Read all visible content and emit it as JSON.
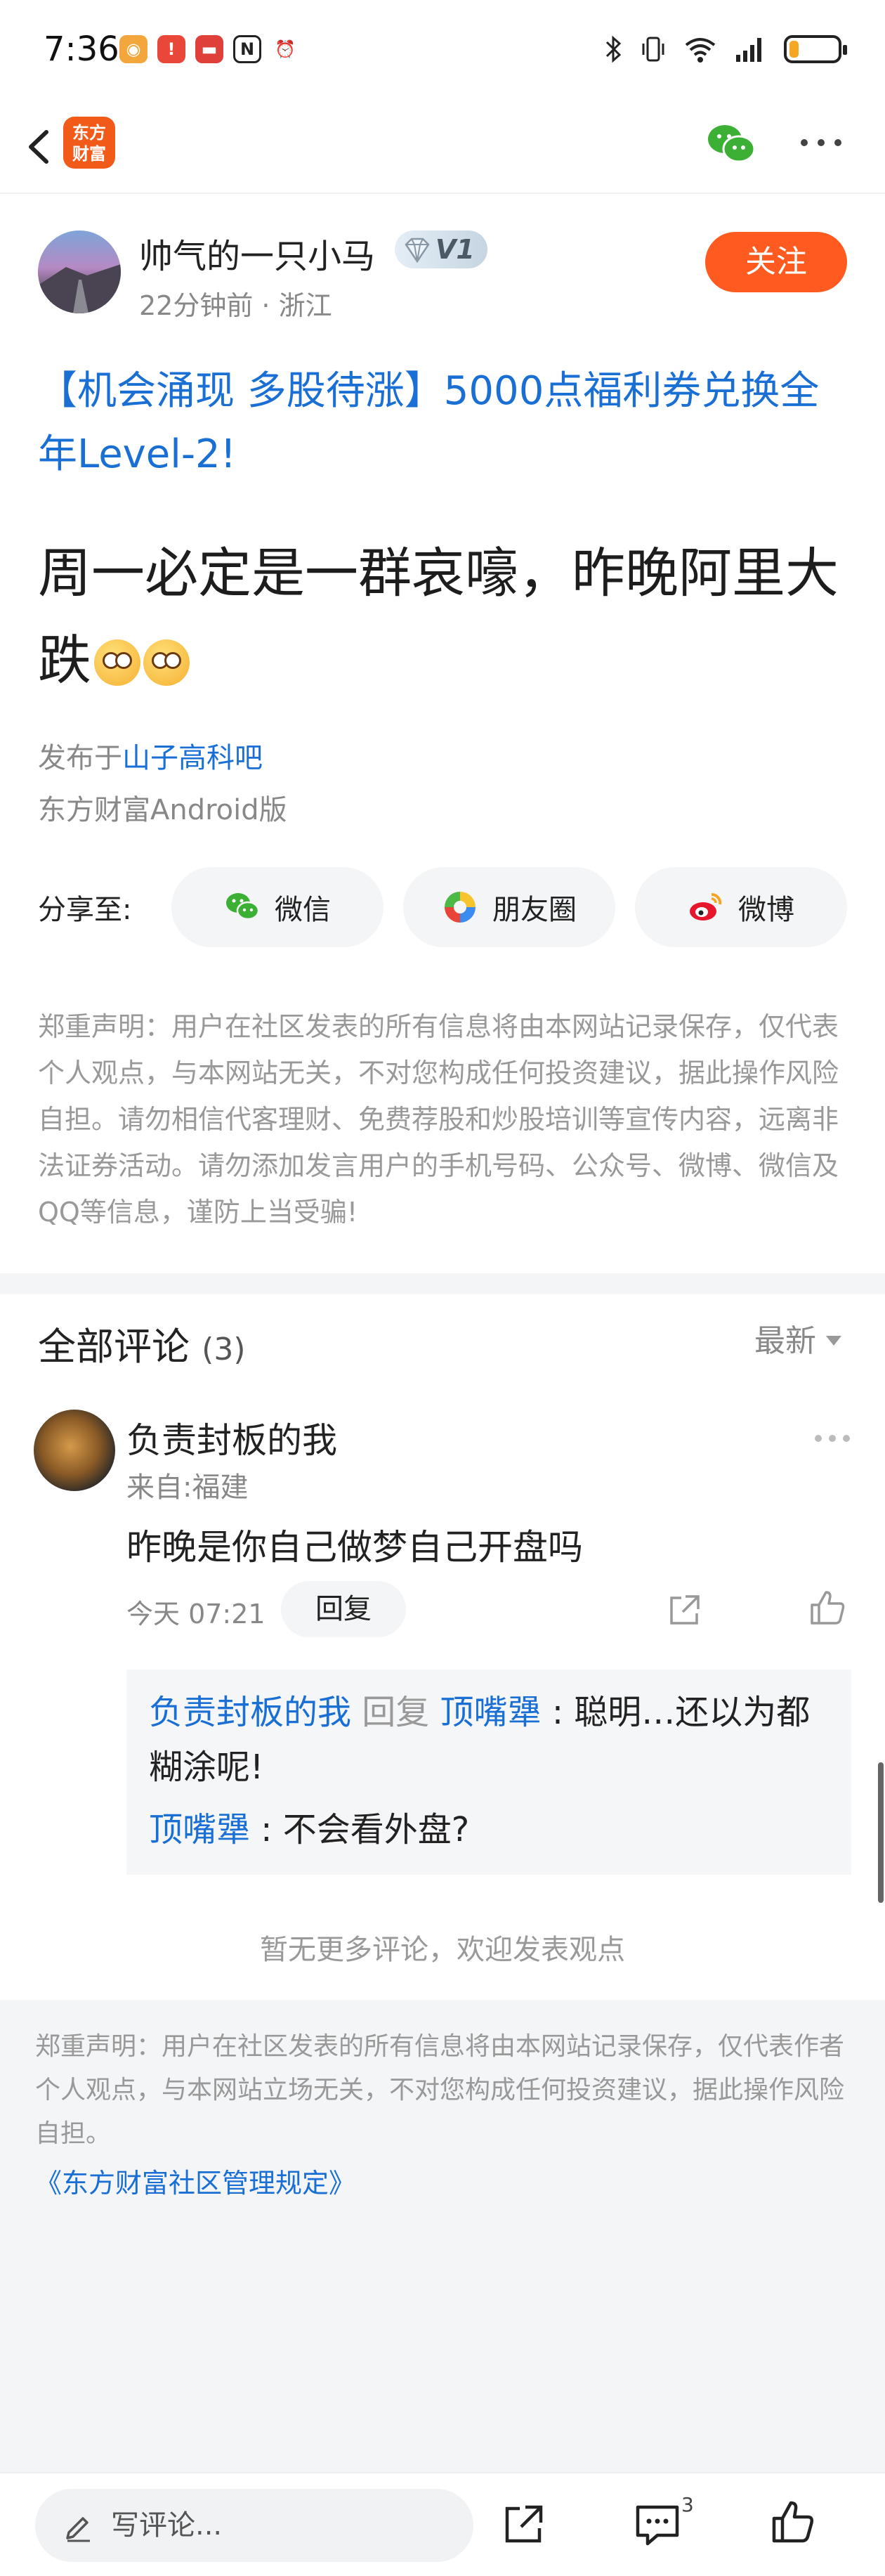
{
  "status_bar": {
    "time": "7:36",
    "battery_level": 0.18,
    "icons": [
      "weibo-icon",
      "notification-icon",
      "mail-icon",
      "nfc-icon",
      "alarm-icon",
      "bluetooth-icon",
      "vibrate-icon",
      "wifi-icon",
      "signal-icon",
      "battery-icon"
    ]
  },
  "nav": {
    "logo_text": "东方财富",
    "logo_line1": "东方",
    "logo_line2": "财富"
  },
  "post": {
    "author": "帅气的一只小马",
    "level_badge": "V1",
    "meta": "22分钟前 · 浙江",
    "follow_label": "关注",
    "promo": "【机会涌现 多股待涨】5000点福利券兑换全年Level-2!",
    "title": "周一必定是一群哀嚎，昨晚阿里大跌",
    "posted_in_prefix": "发布于",
    "bar_name": "山子高科吧",
    "client": "东方财富Android版"
  },
  "share": {
    "label": "分享至:",
    "wechat": "微信",
    "moments": "朋友圈",
    "weibo": "微博"
  },
  "disclaimer_top": "郑重声明：用户在社区发表的所有信息将由本网站记录保存，仅代表个人观点，与本网站无关，不对您构成任何投资建议，据此操作风险自担。请勿相信代客理财、免费荐股和炒股培训等宣传内容，远离非法证券活动。请勿添加发言用户的手机号码、公众号、微博、微信及QQ等信息，谨防上当受骗!",
  "comments": {
    "title": "全部评论",
    "count": "(3)",
    "sort": "最新",
    "items": [
      {
        "author": "负责封板的我",
        "location": "来自:福建",
        "text": "昨晚是你自己做梦自己开盘吗",
        "time": "今天 07:21",
        "reply_label": "回复",
        "replies": [
          {
            "from": "负责封板的我",
            "action": " 回复 ",
            "to": "顶嘴犟",
            "text": " : 聪明…还以为都糊涂呢!"
          },
          {
            "from": "顶嘴犟",
            "text": " : 不会看外盘?"
          }
        ]
      }
    ],
    "no_more": "暂无更多评论，欢迎发表观点"
  },
  "footer": {
    "disclaimer": "郑重声明：用户在社区发表的所有信息将由本网站记录保存，仅代表作者个人观点，与本网站立场无关，不对您构成任何投资建议，据此操作风险自担。",
    "rules_link": "《东方财富社区管理规定》"
  },
  "bottom_bar": {
    "write_placeholder": "写评论...",
    "comment_count": "3"
  },
  "colors": {
    "accent": "#ff5a1f",
    "link": "#1a6fd4",
    "muted": "#999999"
  }
}
